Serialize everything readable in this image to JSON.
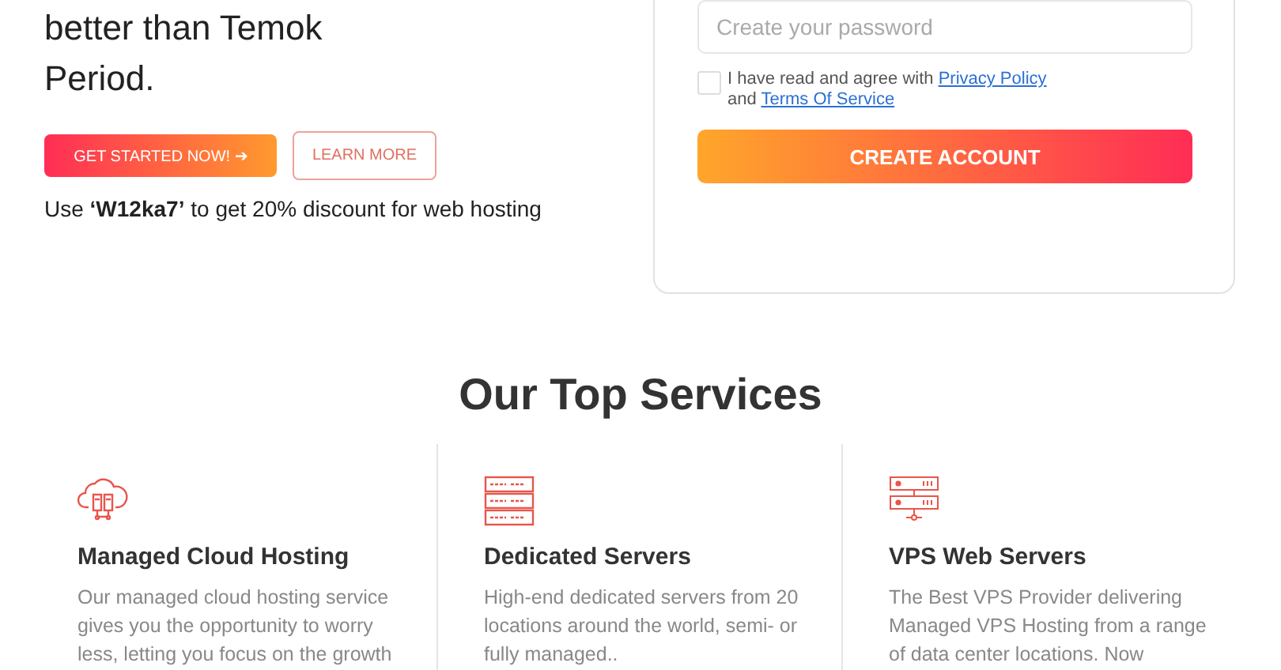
{
  "hero": {
    "headline_lines": [
      "better than Temok",
      "Period."
    ],
    "buttons": [
      {
        "label": "GET STARTED NOW! ➔",
        "kind": "primary"
      },
      {
        "label": "LEARN MORE",
        "kind": "outline"
      }
    ],
    "promo": "Use **‘W12ka7’** to get 20% discount for web hosting"
  },
  "signup": {
    "password": {
      "placeholder": "Create your password"
    },
    "agree": {
      "checked": false,
      "text_before": "I have read and agree with",
      "link_1": "Privacy Policy",
      "text_middle": "and",
      "link_2": "Terms Of Service"
    },
    "submit": "CREATE ACCOUNT"
  },
  "services": {
    "title": "Our Top Services",
    "items": [
      {
        "kind": "cloud",
        "title": "Managed Cloud Hosting",
        "description": "Our managed cloud hosting service gives you the opportunity to worry less, letting you focus on the growth"
      },
      {
        "kind": "rack",
        "title": "Dedicated Servers",
        "description": "High-end dedicated servers from 20 locations around the world, semi- or fully managed.."
      },
      {
        "kind": "vps",
        "title": "VPS Web Servers",
        "description": "The Best VPS Provider delivering Managed VPS Hosting from a range of data center locations. Now"
      }
    ]
  }
}
